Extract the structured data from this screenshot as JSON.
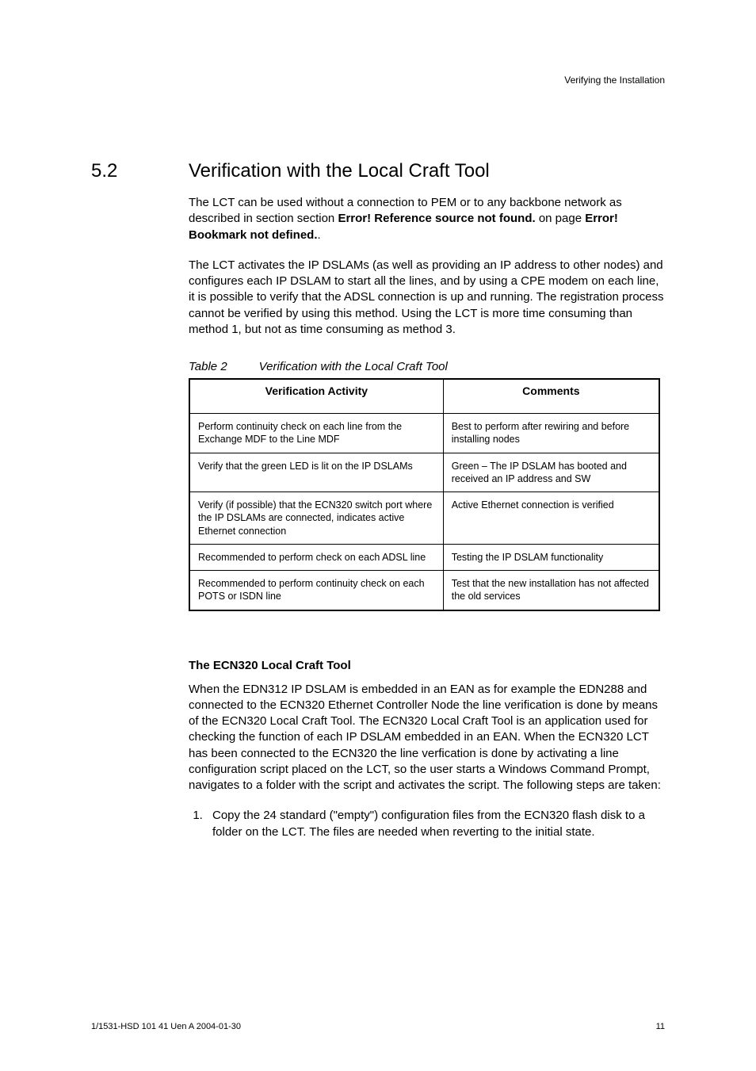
{
  "header": {
    "right_text": "Verifying the Installation"
  },
  "section": {
    "number": "5.2",
    "title": "Verification with the Local Craft Tool"
  },
  "paragraphs": {
    "p1_part1": "The LCT can be used without a connection to PEM or to any backbone network as described in section section ",
    "p1_bold1": "Error! Reference source not found.",
    "p1_part2": " on page ",
    "p1_bold2": "Error! Bookmark not defined.",
    "p1_part3": ".",
    "p2": "The LCT activates the IP DSLAMs (as well as providing an IP address to other nodes) and configures each IP DSLAM to start all the lines, and by using a CPE modem on each line, it is possible to verify that the ADSL connection is up and running. The registration process cannot be verified by using this method. Using the LCT is more time consuming than method 1, but not as time consuming as method 3.",
    "p3": "When the EDN312 IP DSLAM is embedded in an EAN as for example the EDN288 and connected to the ECN320 Ethernet Controller Node the line verification is done by means of the ECN320 Local Craft Tool. The ECN320 Local Craft Tool is an application used for checking the function of each IP DSLAM embedded in an EAN. When the ECN320 LCT has been connected to the ECN320 the line verfication is done by activating a line configuration script placed on the LCT, so the user starts a Windows Command Prompt, navigates to a folder with the script and activates the script.  The following steps are taken:"
  },
  "table": {
    "caption_label": "Table 2",
    "caption_title": "Verification with the Local Craft Tool",
    "headers": {
      "col1": "Verification Activity",
      "col2": "Comments"
    },
    "rows": [
      {
        "activity": "Perform continuity check on each line from the Exchange MDF to the Line MDF",
        "comment": "Best to perform after rewiring and before installing nodes"
      },
      {
        "activity": "Verify that the green LED is lit on the IP DSLAMs",
        "comment": "Green – The IP DSLAM has booted and received an IP address and SW"
      },
      {
        "activity": "Verify (if possible) that the ECN320 switch port where the IP DSLAMs are connected, indicates active Ethernet connection",
        "comment": "Active Ethernet connection is verified"
      },
      {
        "activity": "Recommended to perform check on each ADSL line",
        "comment": "Testing the IP DSLAM functionality"
      },
      {
        "activity": "Recommended to perform continuity check on each POTS or ISDN line",
        "comment": "Test that the new installation has not affected the old services"
      }
    ]
  },
  "subheading": "The ECN320 Local Craft Tool",
  "steps": {
    "s1": "Copy the 24 standard (\"empty\") configuration files from the ECN320 flash disk to a folder on the LCT. The files are needed when reverting to the initial state."
  },
  "footer": {
    "left": "1/1531-HSD 101 41 Uen A   2004-01-30",
    "right": "11"
  }
}
